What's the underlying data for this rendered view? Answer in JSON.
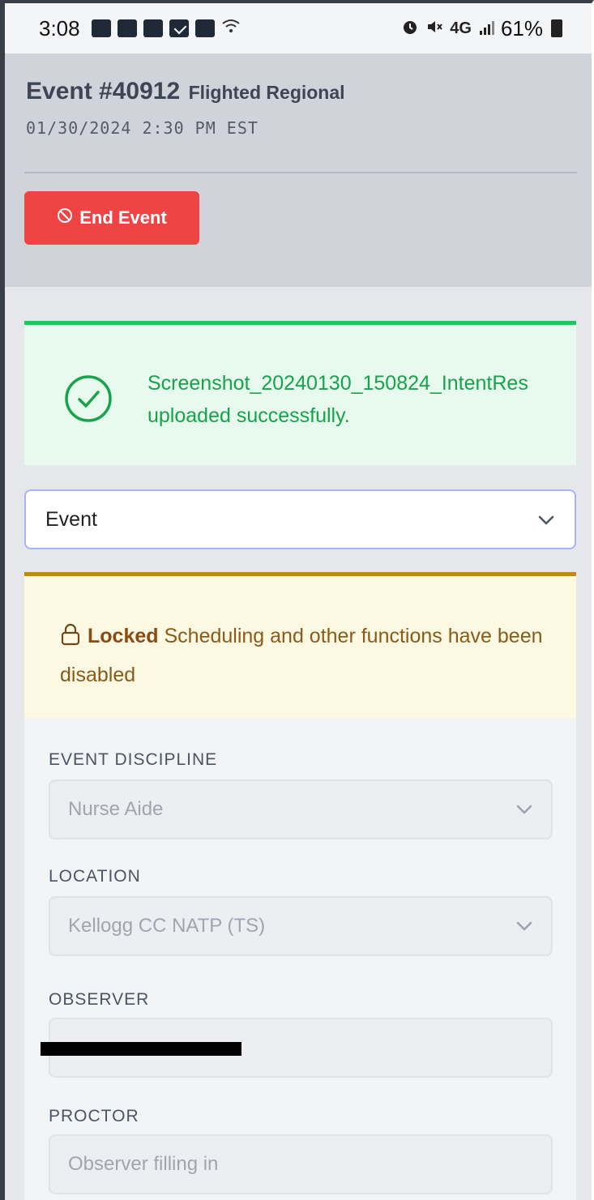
{
  "status_bar": {
    "time": "3:08",
    "network": "4G",
    "battery": "61%"
  },
  "header": {
    "event_number": "Event #40912",
    "event_type": "Flighted Regional",
    "date": "01/30/2024 2:30 PM EST",
    "end_button_label": "End Event"
  },
  "success_alert": {
    "line1": "Screenshot_20240130_150824_IntentRes",
    "line2": "uploaded successfully."
  },
  "view_select": {
    "value": "Event"
  },
  "locked_alert": {
    "bold": "Locked",
    "message": "Scheduling and other functions have been disabled"
  },
  "form": {
    "discipline_label": "EVENT DISCIPLINE",
    "discipline_value": "Nurse Aide",
    "location_label": "LOCATION",
    "location_value": "Kellogg CC NATP (TS)",
    "observer_label": "OBSERVER",
    "proctor_label": "PROCTOR",
    "proctor_placeholder": "Observer filling in"
  },
  "colors": {
    "danger": "#ef4444",
    "success": "#22c55e",
    "warning": "#c2871a"
  }
}
